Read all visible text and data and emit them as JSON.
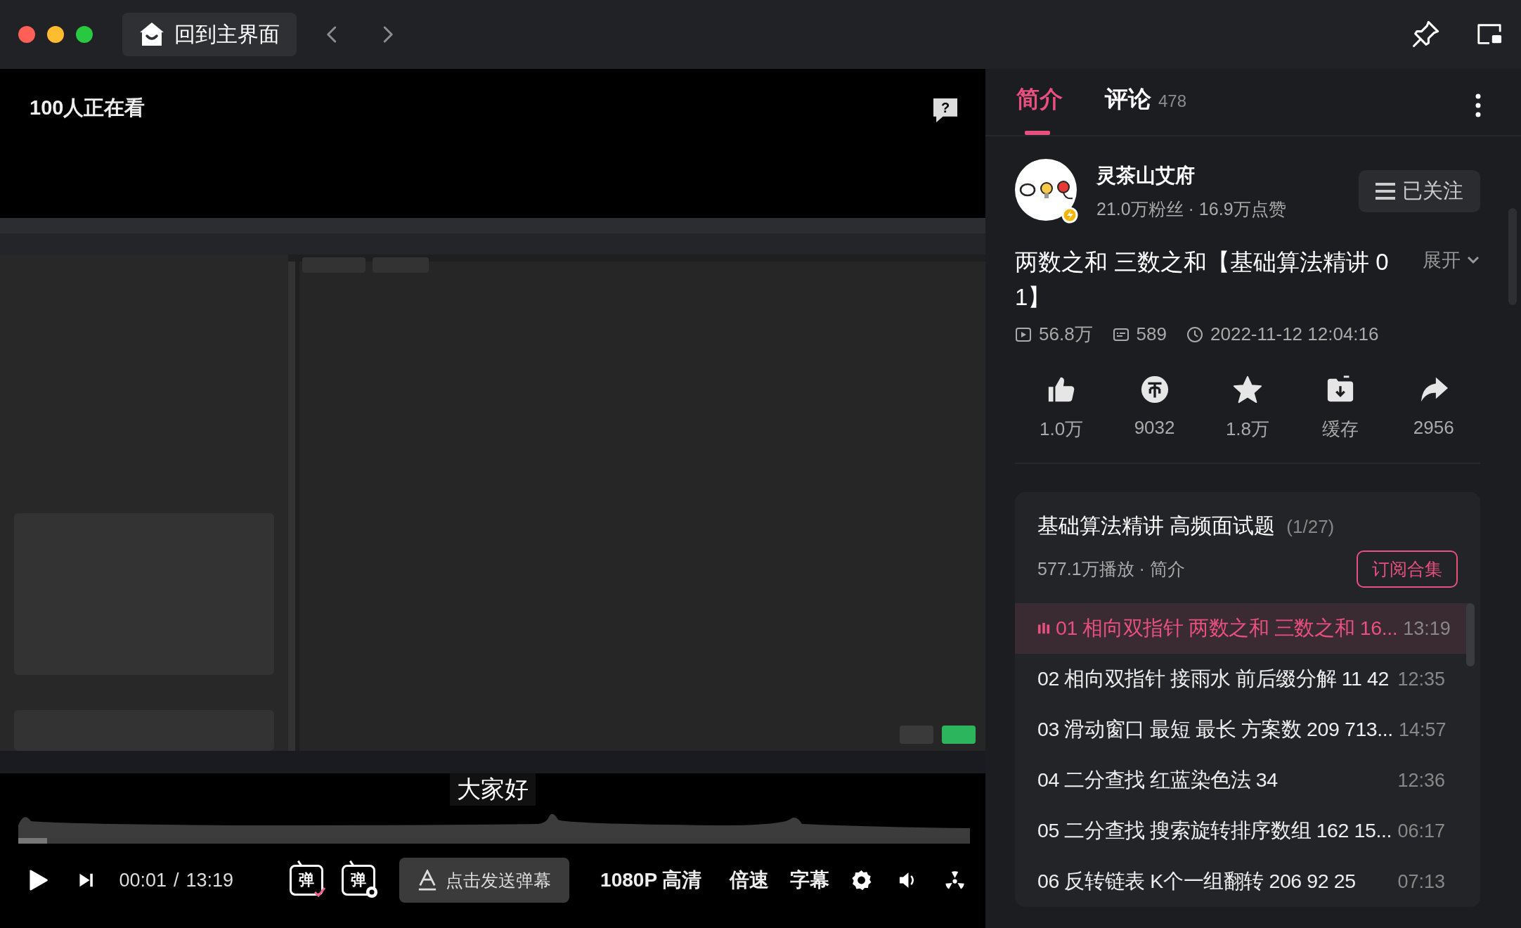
{
  "window": {
    "back_label": "回到主界面"
  },
  "video": {
    "viewers": "100人正在看",
    "help": "?",
    "subtitle": "大家好",
    "progress": {
      "level": 0.03
    },
    "current_time": "00:01",
    "separator": "/",
    "duration": "13:19",
    "danmaku_toggles": [
      "弹",
      "弹"
    ],
    "danmaku_prompt": "点击发送弹幕",
    "quality": "1080P 高清",
    "speed": "倍速",
    "captions": "字幕"
  },
  "tabs": [
    {
      "label": "简介",
      "selected": true
    },
    {
      "label": "评论",
      "count": "478",
      "selected": false
    }
  ],
  "uploader": {
    "name": "灵茶山艾府",
    "stats": "21.0万粉丝 · 16.9万点赞",
    "follow_label": "已关注"
  },
  "video_info": {
    "title": "两数之和 三数之和【基础算法精讲 01】",
    "expand": "展开",
    "views": "56.8万",
    "danmaku_count": "589",
    "date": "2022-11-12 12:04:16"
  },
  "actions": [
    {
      "kind": "like",
      "label": "1.0万"
    },
    {
      "kind": "coin",
      "label": "9032"
    },
    {
      "kind": "favorite",
      "label": "1.8万"
    },
    {
      "kind": "cache",
      "label": "缓存"
    },
    {
      "kind": "share",
      "label": "2956"
    }
  ],
  "collection": {
    "title": "基础算法精讲 高频面试题",
    "position": "(1/27)",
    "meta": "577.1万播放 · 简介",
    "subscribe": "订阅合集",
    "episodes": [
      {
        "title": "01 相向双指针 两数之和 三数之和 16...",
        "duration": "13:19",
        "selected": true
      },
      {
        "title": "02 相向双指针 接雨水 前后缀分解 11 42",
        "duration": "12:35",
        "selected": false
      },
      {
        "title": "03 滑动窗口 最短 最长 方案数 209 713...",
        "duration": "14:57",
        "selected": false
      },
      {
        "title": "04 二分查找 红蓝染色法 34",
        "duration": "12:36",
        "selected": false
      },
      {
        "title": "05 二分查找 搜索旋转排序数组 162 15...",
        "duration": "06:17",
        "selected": false
      },
      {
        "title": "06 反转链表 K个一组翻转 206 92 25",
        "duration": "07:13",
        "selected": false
      }
    ]
  }
}
